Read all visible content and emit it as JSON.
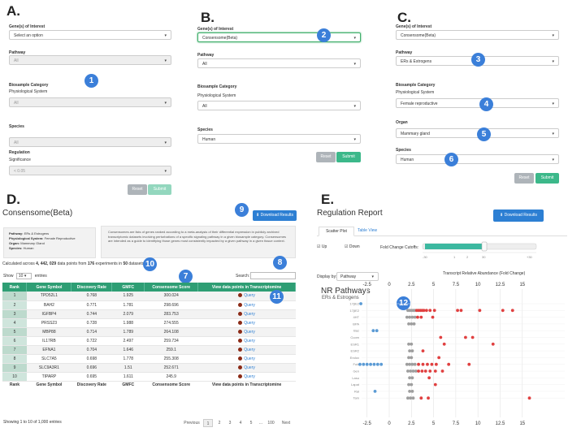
{
  "panels": {
    "a": "A.",
    "b": "B.",
    "c": "C.",
    "d": "D.",
    "e": "E."
  },
  "form_a": {
    "gene_label": "Gene(s) of Interest",
    "gene_value": "Select an option",
    "pathway_label": "Pathway",
    "pathway_value": "All",
    "biosample_label": "Biosample Category",
    "phys_label": "Physiological System",
    "phys_value": "All",
    "species_label": "Species",
    "species_value": "All",
    "regulation_label": "Regulation",
    "significance_label": "Significance",
    "significance_value": "< 0.05",
    "reset": "Reset",
    "submit": "Submit"
  },
  "form_b": {
    "gene_label": "Gene(s) of Interest",
    "gene_value": "Consensome(Beta)",
    "pathway_label": "Pathway",
    "pathway_value": "All",
    "biosample_label": "Biosample Category",
    "phys_label": "Physiological System",
    "phys_value": "All",
    "species_label": "Species",
    "species_value": "Human",
    "reset": "Reset",
    "submit": "Submit"
  },
  "form_c": {
    "gene_label": "Gene(s) of Interest",
    "gene_value": "Consensome(Beta)",
    "pathway_label": "Pathway",
    "pathway_value": "ERs & Estrogens",
    "biosample_label": "Biosample Category",
    "phys_label": "Physiological System",
    "phys_value": "Female reproductive",
    "organ_label": "Organ",
    "organ_value": "Mammary gland",
    "species_label": "Species",
    "species_value": "Human",
    "reset": "Reset",
    "submit": "Submit"
  },
  "badges": [
    "1",
    "2",
    "3",
    "4",
    "5",
    "6",
    "7",
    "8",
    "9",
    "10",
    "11",
    "12"
  ],
  "consensome": {
    "title": "Consensome(Beta)",
    "download": "Download Results",
    "info": {
      "pathway_key": "Pathway:",
      "pathway_val": "ERs & Estrogens",
      "phys_key": "Physiological System:",
      "phys_val": "Female Reproductive",
      "organ_key": "Organ:",
      "organ_val": "Mammary Gland",
      "species_key": "Species:",
      "species_val": "Human"
    },
    "description": "Consensomes are lists of genes ranked according to a meta-analysis of their differential expression in publicly archived transcriptomic datasets involving perturbations of a specific signaling pathway in a given biosample category. Consensomes are intended as a guide to identifying those genes most consistently impacted by a given pathway in a given tissue context.",
    "calc_prefix": "Calculated across",
    "calc_points": "4, 442, 029",
    "calc_mid": "data points from",
    "calc_experiments": "176",
    "calc_mid2": "experiments in",
    "calc_datasets": "50",
    "calc_suffix": "datasets",
    "show_label": "Show",
    "show_value": "10",
    "entries_label": "entries",
    "search_label": "Search:",
    "columns": [
      "Rank",
      "Gene Symbol",
      "Discovery Rate",
      "GMFC",
      "Consensome Score",
      "View data points in Transcriptomine"
    ],
    "query_label": "Query",
    "rows": [
      [
        "1",
        "TPD52L1",
        "0.768",
        "1.925",
        "300.024"
      ],
      [
        "2",
        "BAH2",
        "0.771",
        "1.781",
        "298.696"
      ],
      [
        "3",
        "IGFBP4",
        "0.744",
        "2.079",
        "283.753"
      ],
      [
        "4",
        "PRSS23",
        "0.728",
        "1.988",
        "274.555"
      ],
      [
        "5",
        "MBP88",
        "0.714",
        "1.789",
        "264.108"
      ],
      [
        "6",
        "IL17RB",
        "0.722",
        "2.497",
        "259.734"
      ],
      [
        "7",
        "EFNA1",
        "0.704",
        "1.646",
        "259.1"
      ],
      [
        "8",
        "SLC7A5",
        "0.698",
        "1.778",
        "255.308"
      ],
      [
        "9",
        "SLC9A3R1",
        "0.696",
        "1.51",
        "252.671"
      ],
      [
        "10",
        "TIPARP",
        "0.695",
        "1.611",
        "245.9"
      ]
    ],
    "footer_info": "Showing 1 to 10 of 1,000 entries",
    "pagination": [
      "Previous",
      "1",
      "2",
      "3",
      "4",
      "5",
      "...",
      "100",
      "Next"
    ]
  },
  "regulation": {
    "title": "Regulation Report",
    "download": "Download Results",
    "tab_scatter": "Scatter Plot",
    "tab_table": "Table View",
    "up_label": "Up",
    "down_label": "Down",
    "cutoff_label": "Fold Change Cutoffs:",
    "slider_ticks": [
      "-30",
      "1",
      "2",
      "30",
      "+30"
    ],
    "display_label": "Display by:",
    "display_value": "Pathway",
    "axis_title": "Transcript Relative Abundance (Fold Change)",
    "tick_labels": [
      "-2.5",
      "0",
      "2.5",
      "5",
      "7.5",
      "10",
      "12.5",
      "15"
    ],
    "group_title": "NR Pathways",
    "group_subtitle": "ERs & Estrogens",
    "row_labels": [
      "17βE2",
      "17βE2",
      "4HT",
      "BPA",
      "Baz",
      "Cuom",
      "ESR1",
      "ESR2",
      "Endox",
      "Fulv",
      "Gen",
      "Lasu",
      "Lapat",
      "Ral",
      "Tam"
    ]
  },
  "colors": {
    "up": "#e04040",
    "down": "#5b9bd5",
    "neutral": "#9e9e9e",
    "green": "#2e9e74",
    "blue": "#2d7fd3"
  }
}
